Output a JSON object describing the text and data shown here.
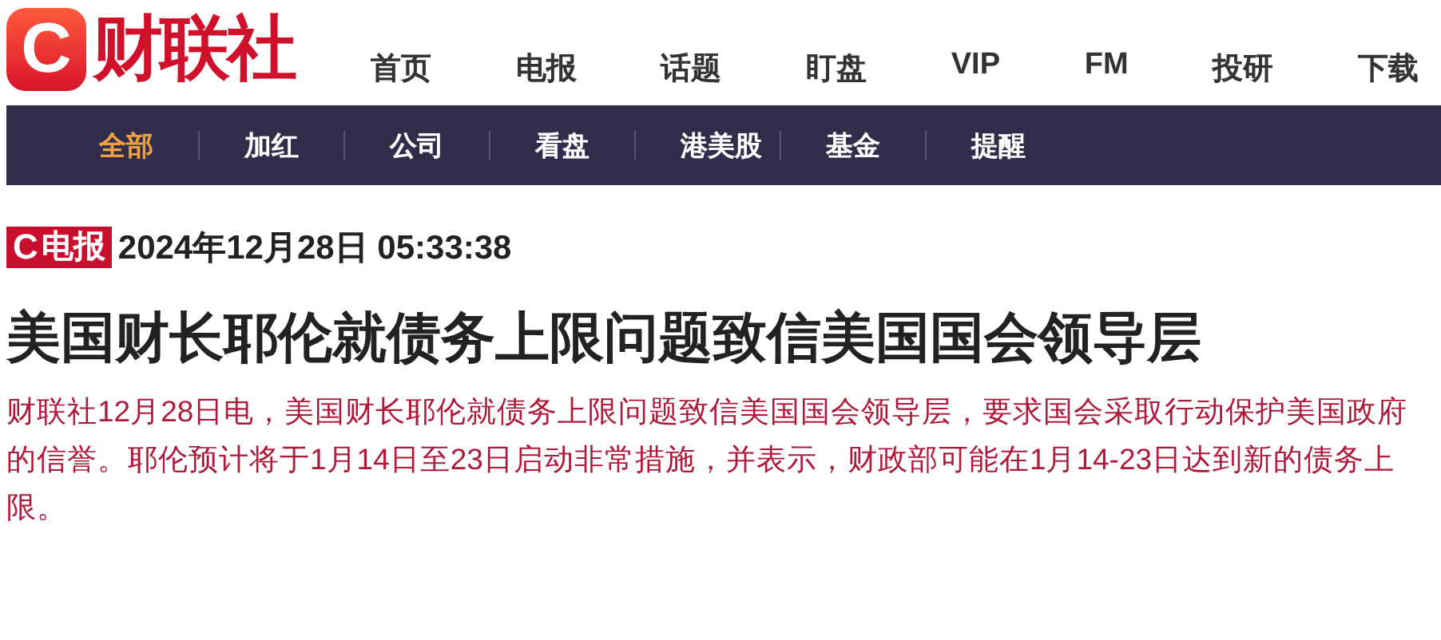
{
  "logo": {
    "mark": "C",
    "name": "财联社"
  },
  "main_nav": [
    "首页",
    "电报",
    "话题",
    "盯盘",
    "VIP",
    "FM",
    "投研",
    "下载"
  ],
  "category_nav": [
    {
      "label": "全部",
      "selected": true
    },
    {
      "label": "加红",
      "selected": false
    },
    {
      "label": "公司",
      "selected": false
    },
    {
      "label": "看盘",
      "selected": false
    },
    {
      "label": "港美股",
      "selected": false
    },
    {
      "label": "基金",
      "selected": false
    },
    {
      "label": "提醒",
      "selected": false
    }
  ],
  "article": {
    "badge": {
      "mark": "C",
      "label": "电报"
    },
    "datetime": "2024年12月28日 05:33:38",
    "headline": "美国财长耶伦就债务上限问题致信美国国会领导层",
    "body": "财联社12月28日电，美国财长耶伦就债务上限问题致信美国国会领导层，要求国会采取行动保护美国政府的信誉。耶伦预计将于1月14日至23日启动非常措施，并表示，财政部可能在1月14-23日达到新的债务上限。"
  }
}
